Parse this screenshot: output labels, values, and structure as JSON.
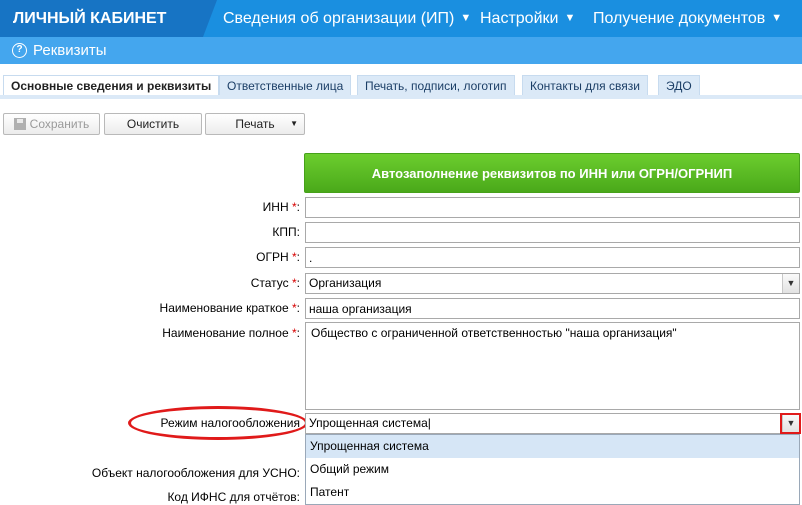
{
  "topbar": {
    "brand": "ЛИЧНЫЙ КАБИНЕТ",
    "nav": [
      {
        "label": "Сведения об организации (ИП)"
      },
      {
        "label": "Настройки"
      },
      {
        "label": "Получение документов"
      }
    ]
  },
  "subheader": {
    "title": "Реквизиты"
  },
  "tabs": [
    {
      "label": "Основные сведения и реквизиты",
      "active": true
    },
    {
      "label": "Ответственные лица"
    },
    {
      "label": "Печать, подписи, логотип"
    },
    {
      "label": "Контакты для связи"
    },
    {
      "label": "ЭДО"
    }
  ],
  "toolbar": {
    "save_label": "Сохранить",
    "clear_label": "Очистить",
    "print_label": "Печать"
  },
  "autofill_label": "Автозаполнение реквизитов по ИНН или ОГРН/ОГРНИП",
  "form": {
    "inn": {
      "label": "ИНН",
      "value": ""
    },
    "kpp": {
      "label": "КПП:",
      "value": ""
    },
    "ogrn": {
      "label": "ОГРН",
      "value": "."
    },
    "status": {
      "label": "Статус",
      "value": "Организация"
    },
    "short_name": {
      "label": "Наименование краткое",
      "value": "наша организация"
    },
    "full_name": {
      "label": "Наименование полное",
      "value": "Общество с ограниченной ответственностью \"наша организация\""
    },
    "tax_regime": {
      "label": "Режим налогообложения",
      "value": "Упрощенная система",
      "options": [
        "Упрощенная система",
        "Общий режим",
        "Патент"
      ]
    },
    "usno_object": {
      "label": "Объект налогообложения для УСНО:"
    },
    "ifns": {
      "label": "Код ИФНС для отчётов:"
    }
  },
  "colors": {
    "topbar": "#1a8fe0",
    "brand_bg": "#1774c4",
    "subheader": "#44a6ee",
    "autofill_green": "#4aa91a",
    "highlight_red": "#e01a1a"
  }
}
